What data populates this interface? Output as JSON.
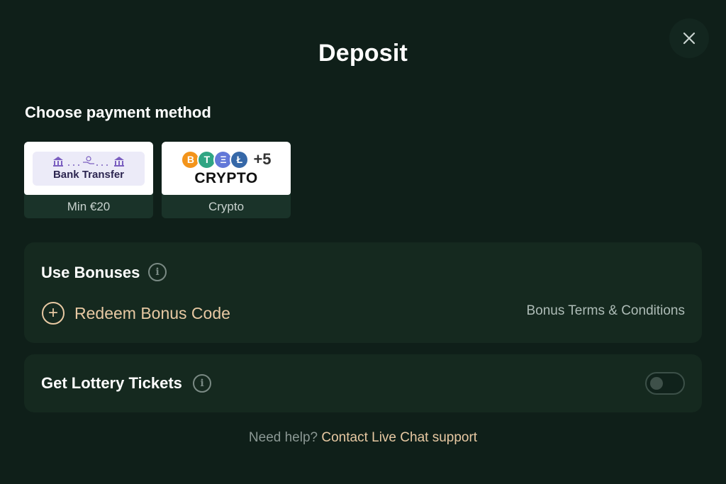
{
  "title": "Deposit",
  "close_icon": "close-icon",
  "payment": {
    "label": "Choose payment method",
    "methods": [
      {
        "logo_text": "Bank Transfer",
        "caption": "Min €20",
        "icon": "bank-icon"
      },
      {
        "logo_text": "CRYPTO",
        "coins": [
          "B",
          "T",
          "Ξ",
          "Ł"
        ],
        "more": "+5",
        "caption": "Crypto"
      }
    ]
  },
  "bonuses": {
    "title": "Use Bonuses",
    "info_icon": "i",
    "redeem_label": "Redeem Bonus Code",
    "terms_link": "Bonus Terms & Conditions"
  },
  "lottery": {
    "title": "Get Lottery Tickets",
    "info_icon": "i",
    "toggle_on": false
  },
  "help": {
    "question": "Need help?",
    "link": "Contact Live Chat support"
  },
  "colors": {
    "background": "#0f1f19",
    "card": "#15291f",
    "accent": "#e8c9a3",
    "muted_text": "#aebcb7"
  }
}
